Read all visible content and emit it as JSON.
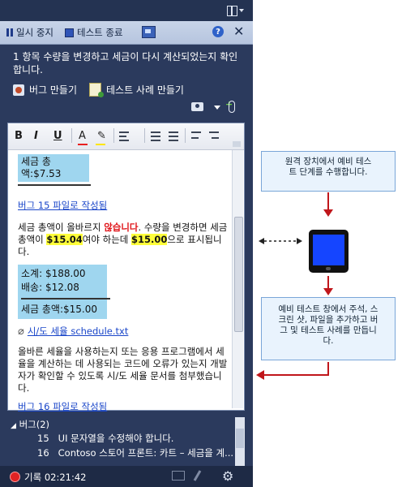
{
  "toolbar": {
    "pause_label": "일시 중지",
    "end_test_label": "테스트 종료",
    "help_icon": "help-icon",
    "close_icon": "close-icon"
  },
  "step": {
    "text": "1  항목 수량을 변경하고 세금이 다시 계산되었는지 확인합니다."
  },
  "actions": {
    "create_bug": "버그 만들기",
    "create_test_case": "테스트 사례 만들기"
  },
  "editor": {
    "format_buttons": [
      "B",
      "I",
      "U",
      "A",
      "✎"
    ],
    "tax_total_1": "세금 총액:$7.53",
    "bug15_link": "버그 15 파일로 작성됨",
    "para_1": "세금 총액이 올바르지",
    "para_1_red": "않습니다",
    "para_1_b": ". 수량을 변경하면 세금 총액이",
    "amount_1": "$15.04",
    "para_1_c": "여야 하는데",
    "amount_2": "$15.00",
    "para_1_d": "으로 표시됩니다.",
    "subtotal": "소계: $188.00",
    "shipping": "배송: $12.08",
    "tax_total_2": "세금 총액:$15.00",
    "attachment": "시/도 세율 schedule.txt",
    "para_2": "올바른 세율을 사용하는지 또는 응용 프로그램에서 세율을 계산하는 데 사용되는 코드에 오류가 있는지 개발자가 확인할 수 있도록 시/도 세율 문서를 첨부했습니다.",
    "bug16_link": "버그 16 파일로 작성됨"
  },
  "bugs": {
    "header": "버그(2)",
    "items": [
      {
        "id": "15",
        "title": "UI 문자열을 수정해야 합니다."
      },
      {
        "id": "16",
        "title": "Contoso 스토어 프론트: 카트 – 세금을 계..."
      }
    ]
  },
  "footer": {
    "recording": "기록 02:21:42"
  },
  "callouts": {
    "top": "원격 장치에서 예비 테스트 단계를 수행합니다.",
    "bottom": "예비 테스트 창에서 주석, 스크린 샷, 파일을 추가하고 버그 및 테스트 사례를 만듭니다."
  },
  "colors": {
    "panel_bg": "#2b3a5d",
    "toolbar_bg": "#c0cee6",
    "highlight_blue": "#9fd6ef",
    "highlight_yellow": "#ffff3a",
    "error_red": "#e0161b",
    "arrow_red": "#c0161b",
    "callout_bg": "#e9f3fd",
    "device_screen": "#1545ff"
  }
}
